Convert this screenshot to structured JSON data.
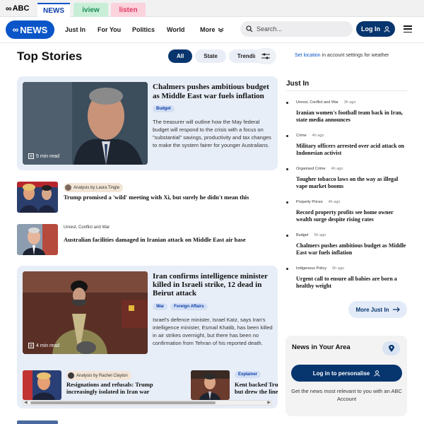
{
  "brand_bar": {
    "abc_label": "ABC",
    "tabs": [
      {
        "label": "NEWS"
      },
      {
        "label": "iview"
      },
      {
        "label": "listen"
      }
    ]
  },
  "nav": {
    "logo_label": "NEWS",
    "items": [
      {
        "label": "Just In"
      },
      {
        "label": "For You"
      },
      {
        "label": "Politics"
      },
      {
        "label": "World"
      },
      {
        "label": "More"
      }
    ],
    "search_placeholder": "Search...",
    "login_label": "Log In"
  },
  "top_stories": {
    "heading": "Top Stories",
    "filters": [
      {
        "label": "All",
        "active": true
      },
      {
        "label": "State",
        "active": false
      },
      {
        "label": "Trending",
        "active": false
      }
    ],
    "weather_link": "Set location",
    "weather_text": " in account settings for weather"
  },
  "feature1": {
    "title": "Chalmers pushes ambitious budget as Middle East war fuels inflation",
    "tags": [
      "Budget"
    ],
    "summary": "The treasurer will outline how the May federal budget will respond to the crisis with a focus on \"substantial\" savings, productivity and tax changes to make the system fairer for younger Australians.",
    "read_time": "5 min read"
  },
  "small_stories": [
    {
      "label": "Analysis by Laura Tingle",
      "title": "Trump promised a 'wild' meeting with Xi, but surely he didn't mean this"
    },
    {
      "label": "Unrest, Conflict and War",
      "title": "Australian facilities damaged in Iranian attack on Middle East air base"
    }
  ],
  "feature2": {
    "title": "Iran confirms intelligence minister killed in Israeli strike, 12 dead in Beirut attack",
    "tags": [
      "War",
      "Foreign Affairs"
    ],
    "summary": "Israel's defence minister, Israel Katz, says Iran's intelligence minister, Esmail Khatib, has been killed in air strikes overnight, but there has been no confirmation from Tehran of his reported death.",
    "read_time": "4 min read",
    "sub_stories": [
      {
        "label": "Analysis by Rachel Clayton",
        "title": "Resignations and refusals: Trump",
        "title2": "increasingly isolated in Iran war"
      },
      {
        "label": "Explainer",
        "title": "Kent backed Trump",
        "title2": "but drew the line"
      }
    ]
  },
  "just_in": {
    "heading": "Just In",
    "items": [
      {
        "category": "Unrest, Conflict and War",
        "ago": "3h ago",
        "title": "Iranian women's football team back in Iran, state media announces"
      },
      {
        "category": "Crime",
        "ago": "4h ago",
        "title": "Military officers arrested over acid attack on Indonesian activist"
      },
      {
        "category": "Organised Crime",
        "ago": "4h ago",
        "title": "Tougher tobacco laws on the way as illegal vape market booms"
      },
      {
        "category": "Property Prices",
        "ago": "4h ago",
        "title": "Record property profits see home owner wealth surge despite rising rates"
      },
      {
        "category": "Budget",
        "ago": "5h ago",
        "title": "Chalmers pushes ambitious budget as Middle East war fuels inflation"
      },
      {
        "category": "Indigenous Policy",
        "ago": "5h ago",
        "title": "Urgent call to ensure all babies are born a healthy weight"
      }
    ],
    "more_label": "More Just In"
  },
  "news_area": {
    "title": "News in Your Area",
    "button_label": "Log in to personalise",
    "description": "Get the news most relevant to you with an ABC Account"
  },
  "colors": {
    "brand_blue": "#0a55c8",
    "navy": "#07356e",
    "card_bg": "#e8eef8"
  }
}
